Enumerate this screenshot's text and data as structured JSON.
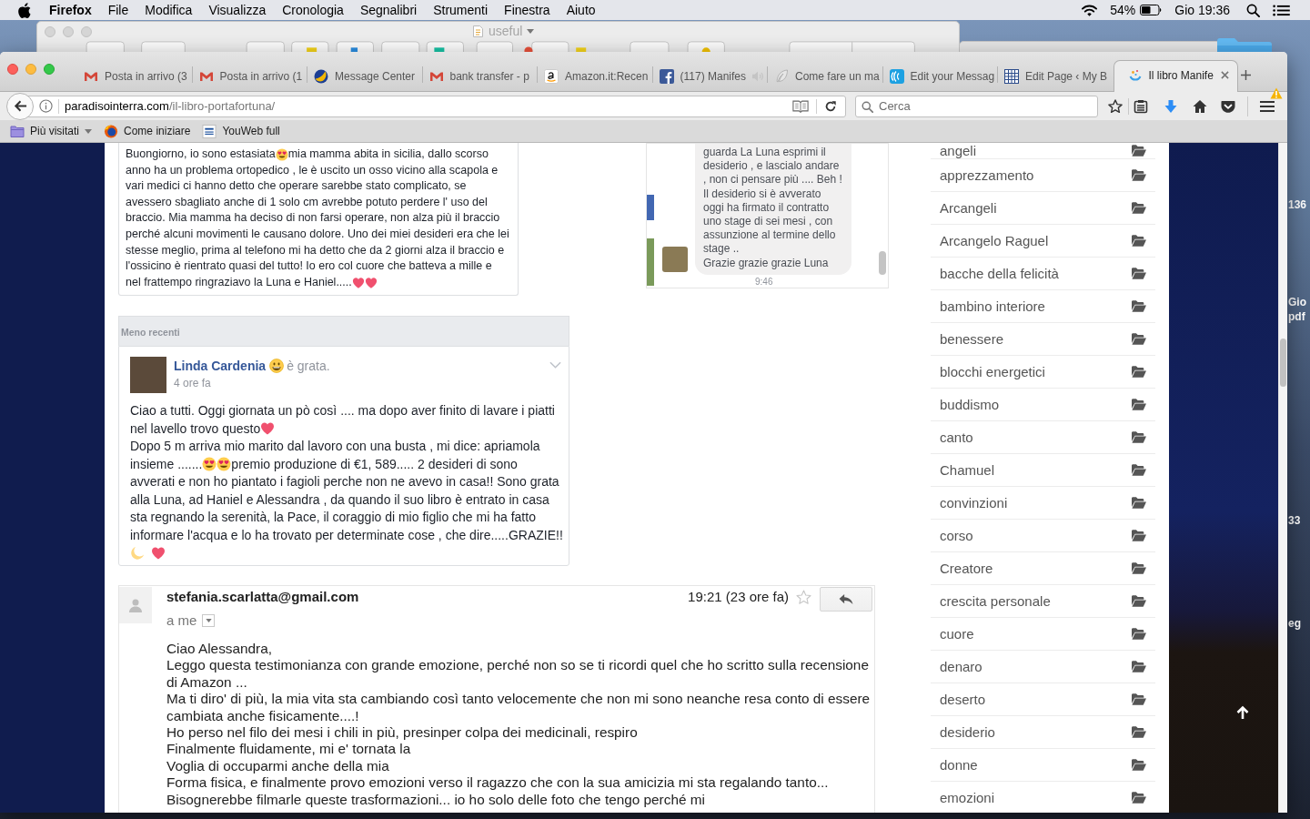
{
  "menubar": {
    "app": "Firefox",
    "menus": [
      "File",
      "Modifica",
      "Visualizza",
      "Cronologia",
      "Segnalibri",
      "Strumenti",
      "Finestra",
      "Aiuto"
    ],
    "battery": "54%",
    "clock": "Gio 19:36"
  },
  "background_window": {
    "title": "useful"
  },
  "desktop_labels": [
    "136",
    "Gio",
    "pdf",
    "33",
    "eg"
  ],
  "tabs": [
    {
      "kind": "gmail",
      "title": "Posta in arrivo (3",
      "audio": false,
      "selected": false
    },
    {
      "kind": "gmail",
      "title": "Posta in arrivo (1",
      "audio": false,
      "selected": false
    },
    {
      "kind": "globe",
      "title": "Message Center",
      "audio": false,
      "selected": false
    },
    {
      "kind": "gmail",
      "title": "bank transfer - p",
      "audio": false,
      "selected": false
    },
    {
      "kind": "amazon",
      "title": "Amazon.it:Recen",
      "audio": false,
      "selected": false
    },
    {
      "kind": "facebook",
      "title": "(117) Manifes",
      "audio": true,
      "selected": false
    },
    {
      "kind": "feather",
      "title": "Come fare un ma",
      "audio": false,
      "selected": false
    },
    {
      "kind": "signal",
      "title": "Edit your Messag",
      "audio": false,
      "selected": false
    },
    {
      "kind": "grid",
      "title": "Edit Page ‹ My B",
      "audio": false,
      "selected": false
    },
    {
      "kind": "swirl",
      "title": "Il libro Manife",
      "audio": false,
      "selected": true
    }
  ],
  "address_bar": {
    "domain": "paradisointerra.com",
    "path": "/il-libro-portafortuna/"
  },
  "search": {
    "placeholder": "Cerca"
  },
  "bookmarks": [
    {
      "kind": "folder",
      "label": "Più visitati"
    },
    {
      "kind": "firefox",
      "label": "Come iniziare"
    },
    {
      "kind": "bank",
      "label": "YouWeb full"
    }
  ],
  "testimonial": {
    "rows": [
      [
        {
          "kind": "text",
          "text": "Buongiorno, io sono estasiata"
        },
        {
          "kind": "hearteyes"
        },
        {
          "kind": "text",
          "text": "mia mamma abita in sicilia, dallo scorso"
        }
      ],
      [
        {
          "kind": "text",
          "text": "anno ha un problema ortopedico , le è uscito un osso vicino alla scapola e vari medici ci hanno detto che operare sarebbe stato complicato, se avessero sbagliato anche di 1 solo cm avrebbe potuto perdere l' uso del braccio. Mia mamma ha deciso di non farsi operare, non alza più il braccio perché alcuni movimenti le causano dolore. Uno dei miei desideri era che lei stesse meglio, prima al telefono mi ha detto che da 2 giorni alza il braccio e l'ossicino è rientrato quasi del tutto! Io ero col cuore che batteva a mille e"
        }
      ],
      [
        {
          "kind": "text",
          "text": "nel frattempo ringraziavo la Luna e Haniel....."
        },
        {
          "kind": "heart"
        },
        {
          "kind": "heart"
        }
      ]
    ]
  },
  "chat": {
    "message": "guarda La Luna esprimi il desiderio , e lascialo andare , non ci pensare più .... Beh ! Il desiderio si è avverato oggi ha firmato il contratto uno stage di sei mesi , con assunzione al termine dello stage ..\nGrazie grazie grazie Luna",
    "time": "9:46"
  },
  "older_posts": {
    "heading": "Meno recenti",
    "post": {
      "author": "Linda Cardenia",
      "feeling": "è grata.",
      "time": "4 ore fa",
      "rows": [
        [
          {
            "kind": "text",
            "text": "Ciao a tutti. Oggi giornata un pò così .... ma dopo aver finito di lavare i piatti"
          }
        ],
        [
          {
            "kind": "text",
            "text": "nel lavello trovo questo"
          },
          {
            "kind": "heart"
          }
        ],
        [
          {
            "kind": "text",
            "text": "Dopo 5 m arriva mio marito dal lavoro con una busta , mi dice: apriamola"
          }
        ],
        [
          {
            "kind": "text",
            "text": "insieme ......."
          },
          {
            "kind": "hearteyes"
          },
          {
            "kind": "hearteyes"
          },
          {
            "kind": "text",
            "text": "premio produzione di €1, 589..... 2 desideri di sono"
          }
        ],
        [
          {
            "kind": "text",
            "text": "avverati e non ho piantato i fagioli perche non ne avevo in casa!! Sono grata alla Luna, ad Haniel e Alessandra , da quando il suo libro è entrato in casa sta regnando la serenità, la Pace, il coraggio di mio figlio che mi ha fatto informare l'acqua e lo ha trovato per determinate cose , che dire.....GRAZIE!!"
          }
        ],
        [
          {
            "kind": "moon"
          },
          {
            "kind": "heart"
          }
        ]
      ]
    }
  },
  "email": {
    "sender": "stefania.scarlatta@gmail.com",
    "recipient": "a me",
    "time": "19:21 (23 ore fa)",
    "starred": false,
    "body": "Ciao Alessandra,\nLeggo questa testimonianza con grande emozione, perché non so se ti ricordi quel che ho scritto sulla recensione di Amazon ...\nMa ti diro' di più, la mia vita sta cambiando così tanto velocemente che non mi sono neanche resa conto di essere cambiata anche fisicamente....!\nHo perso nel filo dei mesi i chili in più, presinper colpa dei medicinali, respiro\nFinalmente fluidamente, mi e' tornata la\nVoglia di occuparmi anche della mia\nForma fisica, e finalmente provo emozioni verso il ragazzo che con la sua amicizia mi sta regalando tanto...\nBisognerebbe filmarle queste trasformazioni... io ho solo delle foto che tengo perché mi"
  },
  "categories": [
    "angeli",
    "apprezzamento",
    "Arcangeli",
    "Arcangelo Raguel",
    "bacche della felicità",
    "bambino interiore",
    "benessere",
    "blocchi energetici",
    "buddismo",
    "canto",
    "Chamuel",
    "convinzioni",
    "corso",
    "Creatore",
    "crescita personale",
    "cuore",
    "denaro",
    "deserto",
    "desiderio",
    "donne",
    "emozioni"
  ]
}
